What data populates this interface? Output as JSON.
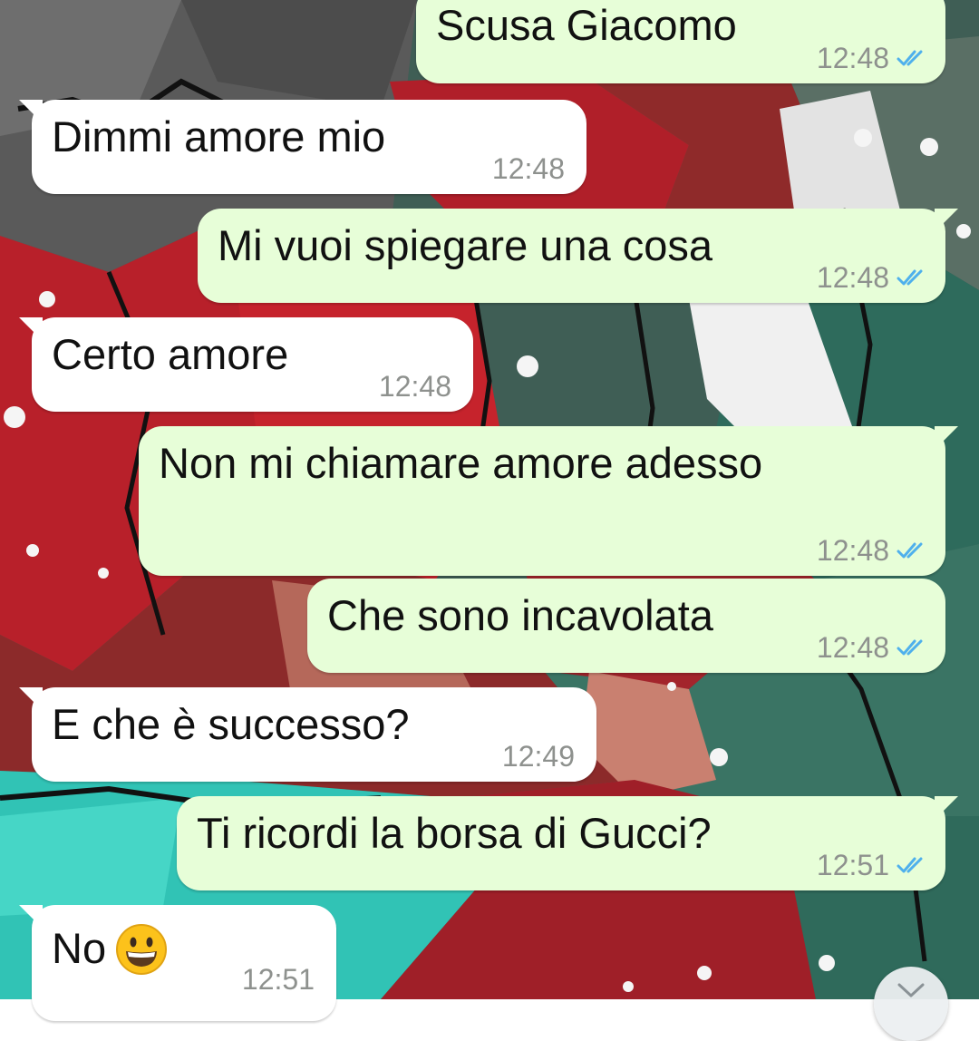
{
  "colors": {
    "outgoing_bubble": "#e7fed8",
    "incoming_bubble": "#ffffff",
    "read_ticks": "#4fb0ec",
    "timestamp": "#8e918e",
    "message_text": "#111111"
  },
  "chat": {
    "messages": [
      {
        "direction": "outgoing",
        "text": "Scusa Giacomo",
        "time": "12:48",
        "status": "read"
      },
      {
        "direction": "incoming",
        "text": "Dimmi amore mio",
        "time": "12:48"
      },
      {
        "direction": "outgoing",
        "text": "Mi vuoi spiegare una cosa",
        "time": "12:48",
        "status": "read"
      },
      {
        "direction": "incoming",
        "text": "Certo amore",
        "time": "12:48"
      },
      {
        "direction": "outgoing",
        "text": "Non mi chiamare amore adesso",
        "time": "12:48",
        "status": "read"
      },
      {
        "direction": "outgoing",
        "text": "Che sono incavolata",
        "time": "12:48",
        "status": "read"
      },
      {
        "direction": "incoming",
        "text": "E che è successo?",
        "time": "12:49"
      },
      {
        "direction": "outgoing",
        "text": "Ti ricordi la borsa di Gucci?",
        "time": "12:51",
        "status": "read"
      },
      {
        "direction": "incoming",
        "text": "No",
        "time": "12:51",
        "emoji": "grinning-face-emoji"
      }
    ]
  },
  "controls": {
    "scroll_down_icon": "chevron-down-icon"
  },
  "wallpaper": {
    "icon": "illustrated-winter-wallpaper"
  }
}
